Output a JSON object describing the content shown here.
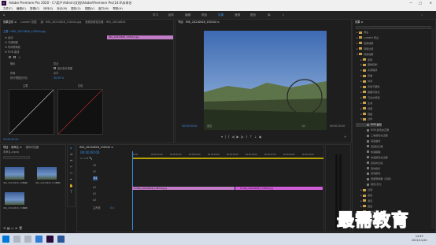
{
  "titlebar": {
    "title": "Adobe Premiere Pro 2020 - C:\\用户\\Admin\\文档\\Adobe\\Premiere Pro\\14.0\\未命名",
    "min": "—",
    "max": "□",
    "close": "✕"
  },
  "menubar": {
    "items": [
      "文件(F)",
      "编辑(E)",
      "剪辑(C)",
      "序列(S)",
      "标记(M)",
      "图形(G)",
      "视图(V)",
      "窗口(W)",
      "帮助(H)"
    ]
  },
  "workspaces": {
    "items": [
      "学习",
      "组件",
      "编辑",
      "颜色",
      "效果",
      "音频",
      "图形",
      "库"
    ],
    "active": "效果"
  },
  "effect_controls": {
    "tabs": [
      "效果控件 ≡",
      "Lumetri 范围",
      "源：IMG_20210828_130544.jpg",
      "音频剪辑混合器：IMG_20210828"
    ],
    "header": "主要 * IMG_20210828_130544.jpg",
    "clip_label": "IMG_20210828_130544.jpg",
    "rows": [
      {
        "label": "fx 运动"
      },
      {
        "label": "fx 不透明度"
      },
      {
        "label": "fx 时间重映射"
      },
      {
        "label": "fx RGB 曲线"
      },
      {
        "label": "输出",
        "value": "复合"
      },
      {
        "label": "",
        "value": "显示拆分视图"
      },
      {
        "label": "布局",
        "value": "水平"
      },
      {
        "label": "拆分视图百分比",
        "value": "50.00 %"
      }
    ],
    "curve_labels": {
      "main": "主要",
      "red": "红色"
    },
    "timecode": "00:00:00:00"
  },
  "program_monitor": {
    "tab": "节目：IMG_20210828_130544 ≡",
    "timecode": "00:00:00:00",
    "fit": "适合",
    "quality": "1/2",
    "duration": "00:00:10:00"
  },
  "project": {
    "tabs": [
      "项目：未命名 ≡",
      "媒体浏览器"
    ],
    "name": "未命名.prproj",
    "items": [
      {
        "name": "IMG_20210828_130544",
        "duration": "5:00"
      },
      {
        "name": "IMG_20210828_174805",
        "duration": "5:00"
      },
      {
        "name": "IMG_20210828_174805",
        "duration": "5:00"
      }
    ]
  },
  "timeline": {
    "tab": "IMG_20210828_130544 ≡",
    "timecode": "00:00:00:00",
    "ruler": [
      "00:00",
      "00:00:01:00",
      "00:00:02:00",
      "00:00:03:00",
      "00:00:04:00",
      "00:00:05:00",
      "00:00:06:00",
      "00:00:07:00",
      "00:00:08:00",
      "00:00:09:00"
    ],
    "tracks": [
      "V3",
      "V2",
      "V1",
      "A1",
      "A2",
      "A3"
    ],
    "master": "主声道",
    "master_value": "0.0",
    "clips": [
      "fx IMG_20210828_130544.jpg",
      "fx IMG_20210828_174805.jpg"
    ]
  },
  "effects": {
    "tab": "效果 ≡",
    "tree": [
      {
        "label": "预设",
        "indent": 1
      },
      {
        "label": "Lumetri 预设",
        "indent": 1
      },
      {
        "label": "音频效果",
        "indent": 1
      },
      {
        "label": "音频过渡",
        "indent": 1
      },
      {
        "label": "视频效果",
        "indent": 1,
        "open": true
      },
      {
        "label": "变换",
        "indent": 2
      },
      {
        "label": "图像控制",
        "indent": 2
      },
      {
        "label": "实用程序",
        "indent": 2
      },
      {
        "label": "扭曲",
        "indent": 2
      },
      {
        "label": "时间",
        "indent": 2
      },
      {
        "label": "杂色与颗粒",
        "indent": 2
      },
      {
        "label": "模糊与锐化",
        "indent": 2
      },
      {
        "label": "沉浸式视频",
        "indent": 2
      },
      {
        "label": "生成",
        "indent": 2
      },
      {
        "label": "视频",
        "indent": 2
      },
      {
        "label": "调整",
        "indent": 2
      },
      {
        "label": "过时",
        "indent": 2,
        "open": true
      },
      {
        "label": "RGB 曲线",
        "indent": 3,
        "selected": true
      },
      {
        "label": "RGB 颜色校正器",
        "indent": 3
      },
      {
        "label": "三向颜色校正器",
        "indent": 3
      },
      {
        "label": "亮度曲线",
        "indent": 3
      },
      {
        "label": "亮度校正器",
        "indent": 3
      },
      {
        "label": "快速模糊",
        "indent": 3
      },
      {
        "label": "快速颜色校正器",
        "indent": 3
      },
      {
        "label": "自动对比度",
        "indent": 3
      },
      {
        "label": "自动色阶",
        "indent": 3
      },
      {
        "label": "自动颜色",
        "indent": 3
      },
      {
        "label": "视频限幅器（旧版）",
        "indent": 3
      },
      {
        "label": "阴影/高光",
        "indent": 3
      },
      {
        "label": "过渡",
        "indent": 2
      },
      {
        "label": "透视",
        "indent": 2
      },
      {
        "label": "通道",
        "indent": 2
      },
      {
        "label": "键控",
        "indent": 2
      },
      {
        "label": "颜色校正",
        "indent": 2
      },
      {
        "label": "风格化",
        "indent": 2
      },
      {
        "label": "视频过渡",
        "indent": 1
      }
    ]
  },
  "watermark": "最需教育",
  "taskbar": {
    "time": "14:45",
    "date": "2021/11/24"
  }
}
